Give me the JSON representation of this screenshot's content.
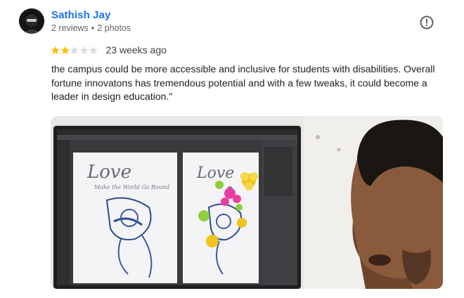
{
  "reviewer": {
    "name": "Sathish Jay",
    "review_count": "2 reviews",
    "photo_count": "2 photos",
    "separator": "•"
  },
  "review": {
    "rating": 2,
    "max_rating": 5,
    "age": "23 weeks ago",
    "text": "the campus could be more accessible and inclusive for students with disabilities. Overall fortune innovatons has tremendous potential and with a few tweaks, it could become a leader in design education.\""
  },
  "colors": {
    "name_link": "#1a73e8",
    "star_filled": "#fbbc04",
    "star_empty": "#dadce0",
    "meta_text": "#5f6368"
  },
  "icons": {
    "report": "report-icon",
    "avatar": "avatar-icon",
    "star": "star-icon"
  }
}
